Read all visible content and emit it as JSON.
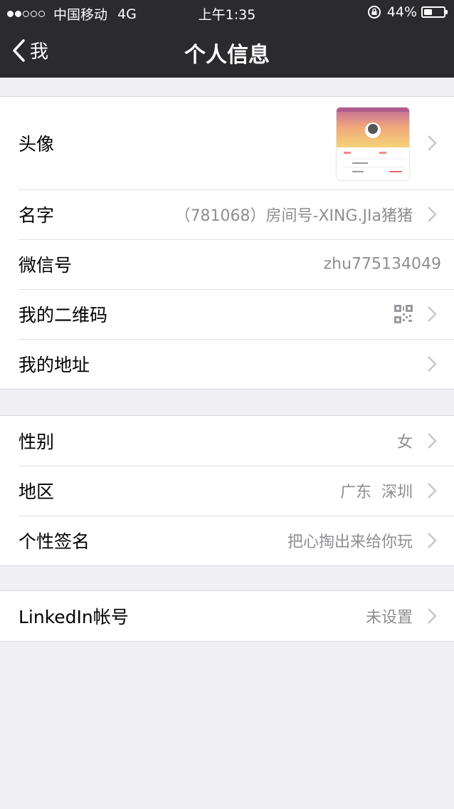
{
  "status_bar": {
    "carrier": "中国移动",
    "network": "4G",
    "time": "上午1:35",
    "battery": "44%",
    "battery_level": 0.44,
    "signal_bars": 2
  },
  "nav": {
    "back_label": "我",
    "title": "个人信息"
  },
  "sections": {
    "profile": {
      "avatar_label": "头像",
      "name_label": "名字",
      "name_value": "（781068）房间号-XING.JIa猪猪",
      "wechat_id_label": "微信号",
      "wechat_id_value": "zhu775134049",
      "qr_label": "我的二维码",
      "address_label": "我的地址"
    },
    "details": {
      "gender_label": "性别",
      "gender_value": "女",
      "region_label": "地区",
      "region_value": "广东  深圳",
      "signature_label": "个性签名",
      "signature_value": "把心掏出来给你玩"
    },
    "linkedin": {
      "label": "LinkedIn帐号",
      "value": "未设置"
    }
  },
  "colors": {
    "nav_bg": "#2b2b2e",
    "page_bg": "#efeff4",
    "value_text": "#8e8e93"
  }
}
